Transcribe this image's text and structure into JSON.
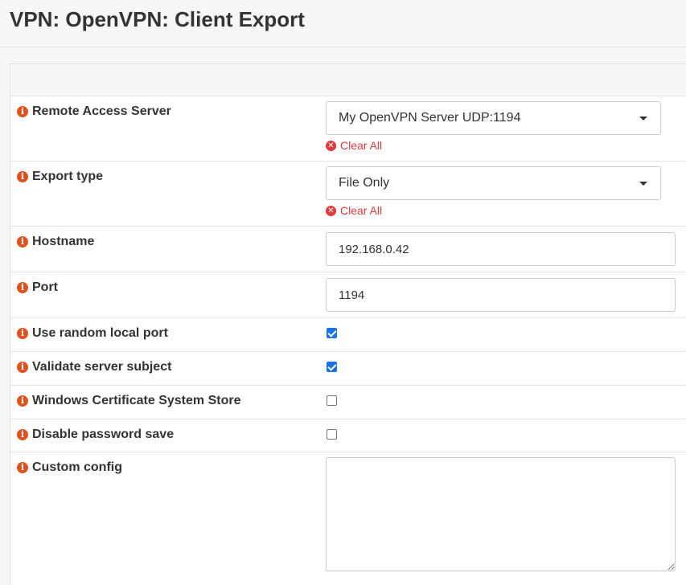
{
  "page": {
    "title": "VPN: OpenVPN: Client Export"
  },
  "form": {
    "remote_access_server": {
      "label": "Remote Access Server",
      "value": "My OpenVPN Server UDP:1194",
      "clear_label": "Clear All"
    },
    "export_type": {
      "label": "Export type",
      "value": "File Only",
      "clear_label": "Clear All"
    },
    "hostname": {
      "label": "Hostname",
      "value": "192.168.0.42"
    },
    "port": {
      "label": "Port",
      "value": "1194"
    },
    "use_random_local_port": {
      "label": "Use random local port",
      "checked": true
    },
    "validate_server_subject": {
      "label": "Validate server subject",
      "checked": true
    },
    "windows_cert_store": {
      "label": "Windows Certificate System Store",
      "checked": false
    },
    "disable_password_save": {
      "label": "Disable password save",
      "checked": false
    },
    "custom_config": {
      "label": "Custom config",
      "value": ""
    }
  },
  "icons": {
    "info": "info-icon",
    "clear": "clear-x-icon",
    "dropdown": "chevron-down-icon"
  },
  "colors": {
    "info_icon": "#e2511d",
    "clear_link": "#e03c3c",
    "checkbox_checked": "#1a73e8"
  }
}
